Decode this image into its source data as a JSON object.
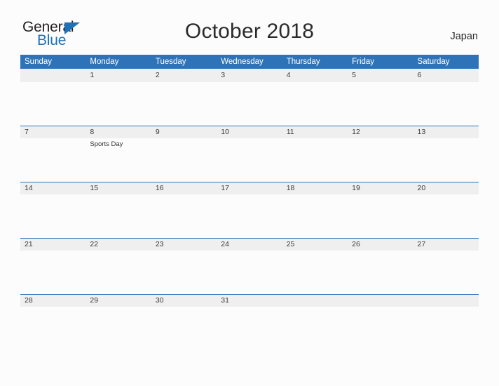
{
  "brand": {
    "word_one": "General",
    "word_two": "Blue",
    "accent_color": "#1d71b8"
  },
  "header": {
    "title": "October 2018",
    "region": "Japan"
  },
  "calendar": {
    "header_color": "#2e73b8",
    "band_color": "#efefef",
    "weekdays": [
      "Sunday",
      "Monday",
      "Tuesday",
      "Wednesday",
      "Thursday",
      "Friday",
      "Saturday"
    ],
    "weeks": [
      {
        "days": [
          {
            "date": "",
            "events": []
          },
          {
            "date": "1",
            "events": []
          },
          {
            "date": "2",
            "events": []
          },
          {
            "date": "3",
            "events": []
          },
          {
            "date": "4",
            "events": []
          },
          {
            "date": "5",
            "events": []
          },
          {
            "date": "6",
            "events": []
          }
        ]
      },
      {
        "days": [
          {
            "date": "7",
            "events": []
          },
          {
            "date": "8",
            "events": [
              "Sports Day"
            ]
          },
          {
            "date": "9",
            "events": []
          },
          {
            "date": "10",
            "events": []
          },
          {
            "date": "11",
            "events": []
          },
          {
            "date": "12",
            "events": []
          },
          {
            "date": "13",
            "events": []
          }
        ]
      },
      {
        "days": [
          {
            "date": "14",
            "events": []
          },
          {
            "date": "15",
            "events": []
          },
          {
            "date": "16",
            "events": []
          },
          {
            "date": "17",
            "events": []
          },
          {
            "date": "18",
            "events": []
          },
          {
            "date": "19",
            "events": []
          },
          {
            "date": "20",
            "events": []
          }
        ]
      },
      {
        "days": [
          {
            "date": "21",
            "events": []
          },
          {
            "date": "22",
            "events": []
          },
          {
            "date": "23",
            "events": []
          },
          {
            "date": "24",
            "events": []
          },
          {
            "date": "25",
            "events": []
          },
          {
            "date": "26",
            "events": []
          },
          {
            "date": "27",
            "events": []
          }
        ]
      },
      {
        "days": [
          {
            "date": "28",
            "events": []
          },
          {
            "date": "29",
            "events": []
          },
          {
            "date": "30",
            "events": []
          },
          {
            "date": "31",
            "events": []
          },
          {
            "date": "",
            "events": []
          },
          {
            "date": "",
            "events": []
          },
          {
            "date": "",
            "events": []
          }
        ]
      }
    ]
  }
}
